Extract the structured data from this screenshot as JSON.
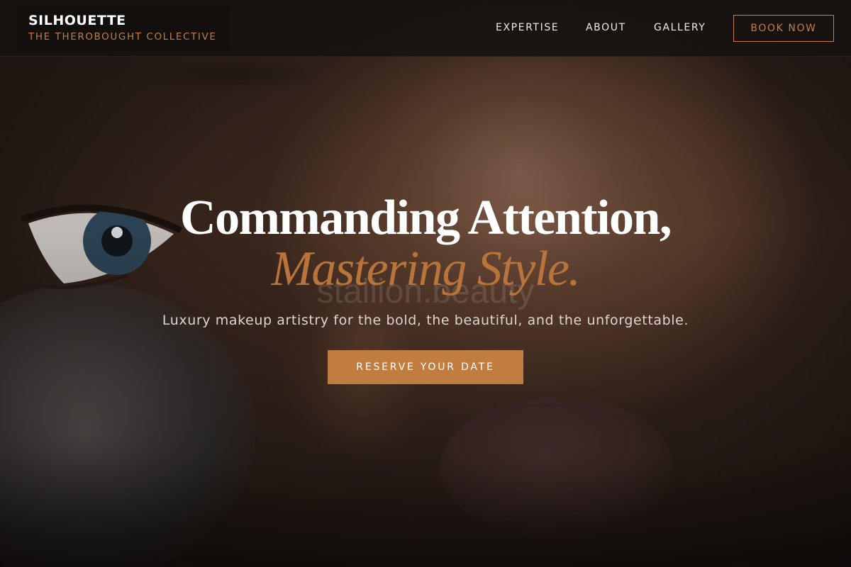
{
  "colors": {
    "accent": "#c17d42",
    "header_bg": "#161210",
    "text_light": "#ffffff"
  },
  "header": {
    "brand_name": "SILHOUETTE",
    "brand_tagline": "THE THEROBOUGHT COLLECTIVE",
    "nav": {
      "expertise": "EXPERTISE",
      "about": "ABOUT",
      "gallery": "GALLERY"
    },
    "book_label": "BOOK NOW"
  },
  "hero": {
    "title": "Commanding Attention,",
    "accent": "Mastering Style.",
    "watermark": "stallion.beauty",
    "subtitle": "Luxury makeup artistry for the bold, the beautiful, and the unforgettable.",
    "cta_label": "RESERVE YOUR DATE"
  }
}
